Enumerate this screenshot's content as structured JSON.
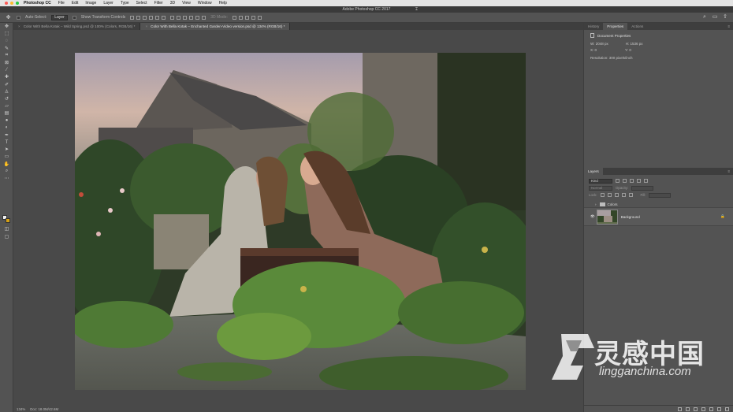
{
  "menubar": {
    "app": "Photoshop CC",
    "items": [
      "File",
      "Edit",
      "Image",
      "Layer",
      "Type",
      "Select",
      "Filter",
      "3D",
      "View",
      "Window",
      "Help"
    ]
  },
  "window": {
    "title": "Adobe Photoshop CC 2017"
  },
  "options_bar": {
    "auto_select_label": "Auto-Select:",
    "auto_select_value": "Layer",
    "transform_label": "Show Transform Controls",
    "mode_3d_label": "3D Mode:"
  },
  "tabs": [
    {
      "label": "Color With Bella Kotak – Wild Spring.psd @ 100% (Colors, RGB/16) *",
      "active": false
    },
    {
      "label": "Color With Bella Kotak – Enchanted Garden-Video version.psd @ 134% (RGB/16) *",
      "active": true
    }
  ],
  "panels": {
    "top_tabs": [
      "History",
      "Properties",
      "Actions"
    ],
    "properties": {
      "header": "Document Properties",
      "width_label": "W:",
      "width_value": "2048 px",
      "height_label": "H:",
      "height_value": "1536 px",
      "x_label": "X:",
      "x_value": "0",
      "y_label": "Y:",
      "y_value": "0",
      "resolution": "Resolution: 300 pixels/inch"
    },
    "layers": {
      "tab": "Layers",
      "kind_label": "Kind",
      "mode_label": "Normal",
      "opacity_label": "Opacity:",
      "lock_label": "Lock:",
      "fill_label": "Fill:",
      "items": [
        {
          "name": "Colors",
          "type": "group"
        },
        {
          "name": "Background",
          "type": "image"
        }
      ]
    }
  },
  "status": {
    "zoom": "134%",
    "doc_info": "Doc: 18.0M/42.6M"
  },
  "watermark": {
    "chinese": "灵感中国",
    "url": "lingganchina.com"
  },
  "colors": {
    "accent_fg": "#f0f0f0",
    "accent_bg": "#d4a016",
    "ui_dark": "#3e3e3e",
    "ui_mid": "#535353"
  }
}
